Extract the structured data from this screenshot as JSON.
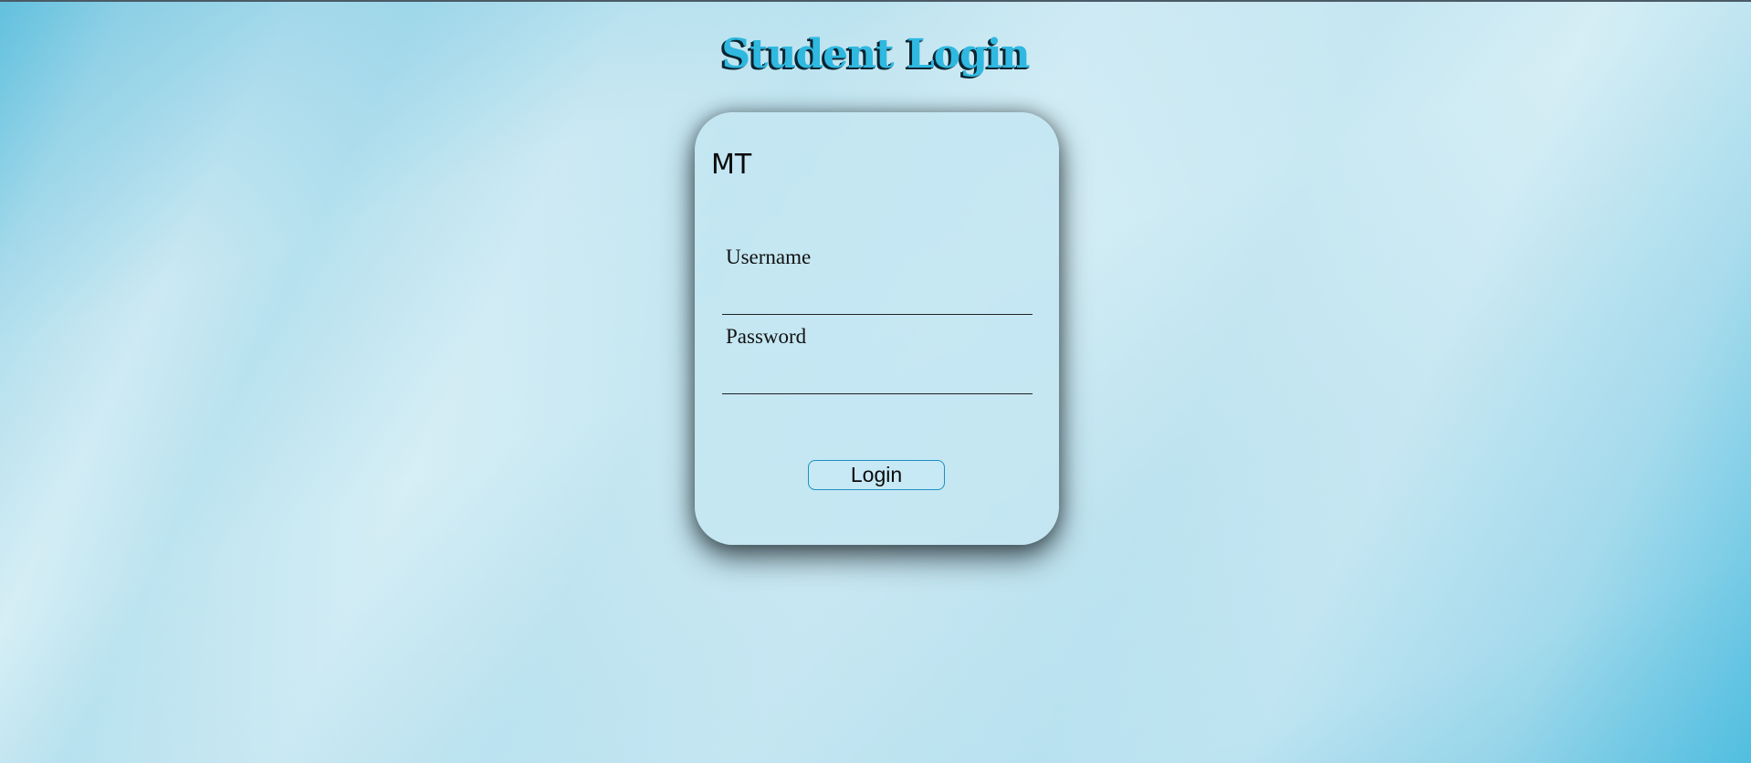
{
  "page": {
    "title": "Student Login"
  },
  "card": {
    "logo_text": "MT",
    "username_label": "Username",
    "username_value": "",
    "username_placeholder": "",
    "password_label": "Password",
    "password_value": "",
    "password_placeholder": "",
    "login_button_label": "Login"
  },
  "colors": {
    "title_fill": "#2fb8e0",
    "title_shadow": "#0b2430",
    "button_border": "#1f8fc0"
  }
}
